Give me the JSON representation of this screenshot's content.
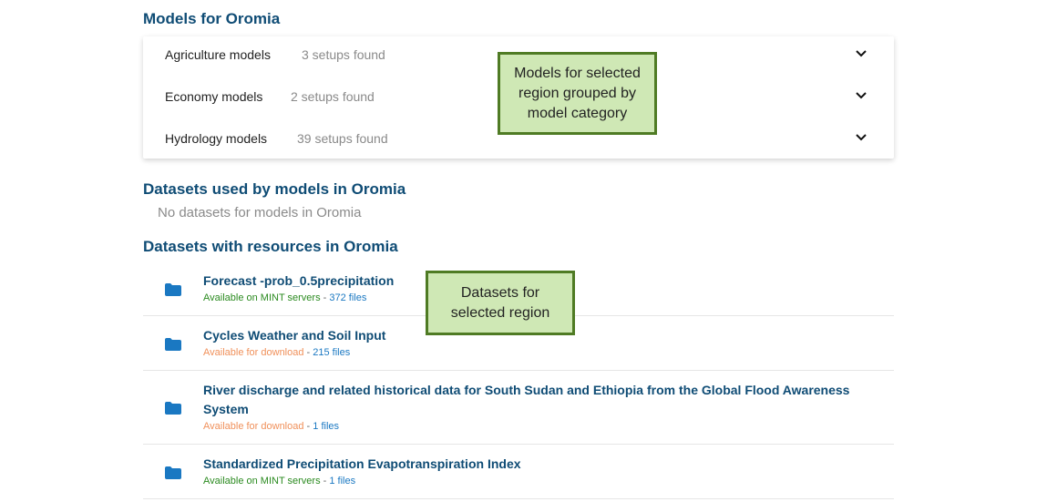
{
  "models_section": {
    "title": "Models for Oromia",
    "categories": [
      {
        "name": "Agriculture models",
        "count": "3 setups found"
      },
      {
        "name": "Economy models",
        "count": "2 setups found"
      },
      {
        "name": "Hydrology models",
        "count": "39 setups found"
      }
    ]
  },
  "datasets_used_section": {
    "title": "Datasets used by models in Oromia",
    "empty_text": "No datasets for models in Oromia"
  },
  "datasets_resources_section": {
    "title": "Datasets with resources in Oromia",
    "items": [
      {
        "title": "Forecast -prob_0.5precipitation",
        "availability": "Available on MINT servers",
        "separator": " - ",
        "files": "372 files"
      },
      {
        "title": "Cycles Weather and Soil Input",
        "availability": "Available for download",
        "separator": " - ",
        "files": "215 files"
      },
      {
        "title": "River discharge and related historical data for South Sudan and Ethiopia from the Global Flood Awareness System",
        "availability": "Available for download",
        "separator": " - ",
        "files": "1 files"
      },
      {
        "title": "Standardized Precipitation Evapotranspiration Index",
        "availability": "Available on MINT servers",
        "separator": " - ",
        "files": "1 files"
      }
    ]
  },
  "annotations": {
    "models": "Models for selected\nregion grouped by\nmodel category",
    "datasets": "Datasets for\nselected region"
  },
  "colors": {
    "heading": "#0f4c75",
    "mint_available": "#2a8a1f",
    "download_available": "#f0905a",
    "files_link": "#1a78c2",
    "annotation_bg": "#cfe8b5",
    "annotation_border": "#4f7b24"
  },
  "icons": {
    "category_toggle": "chevron-down-icon",
    "dataset": "folder-icon"
  }
}
